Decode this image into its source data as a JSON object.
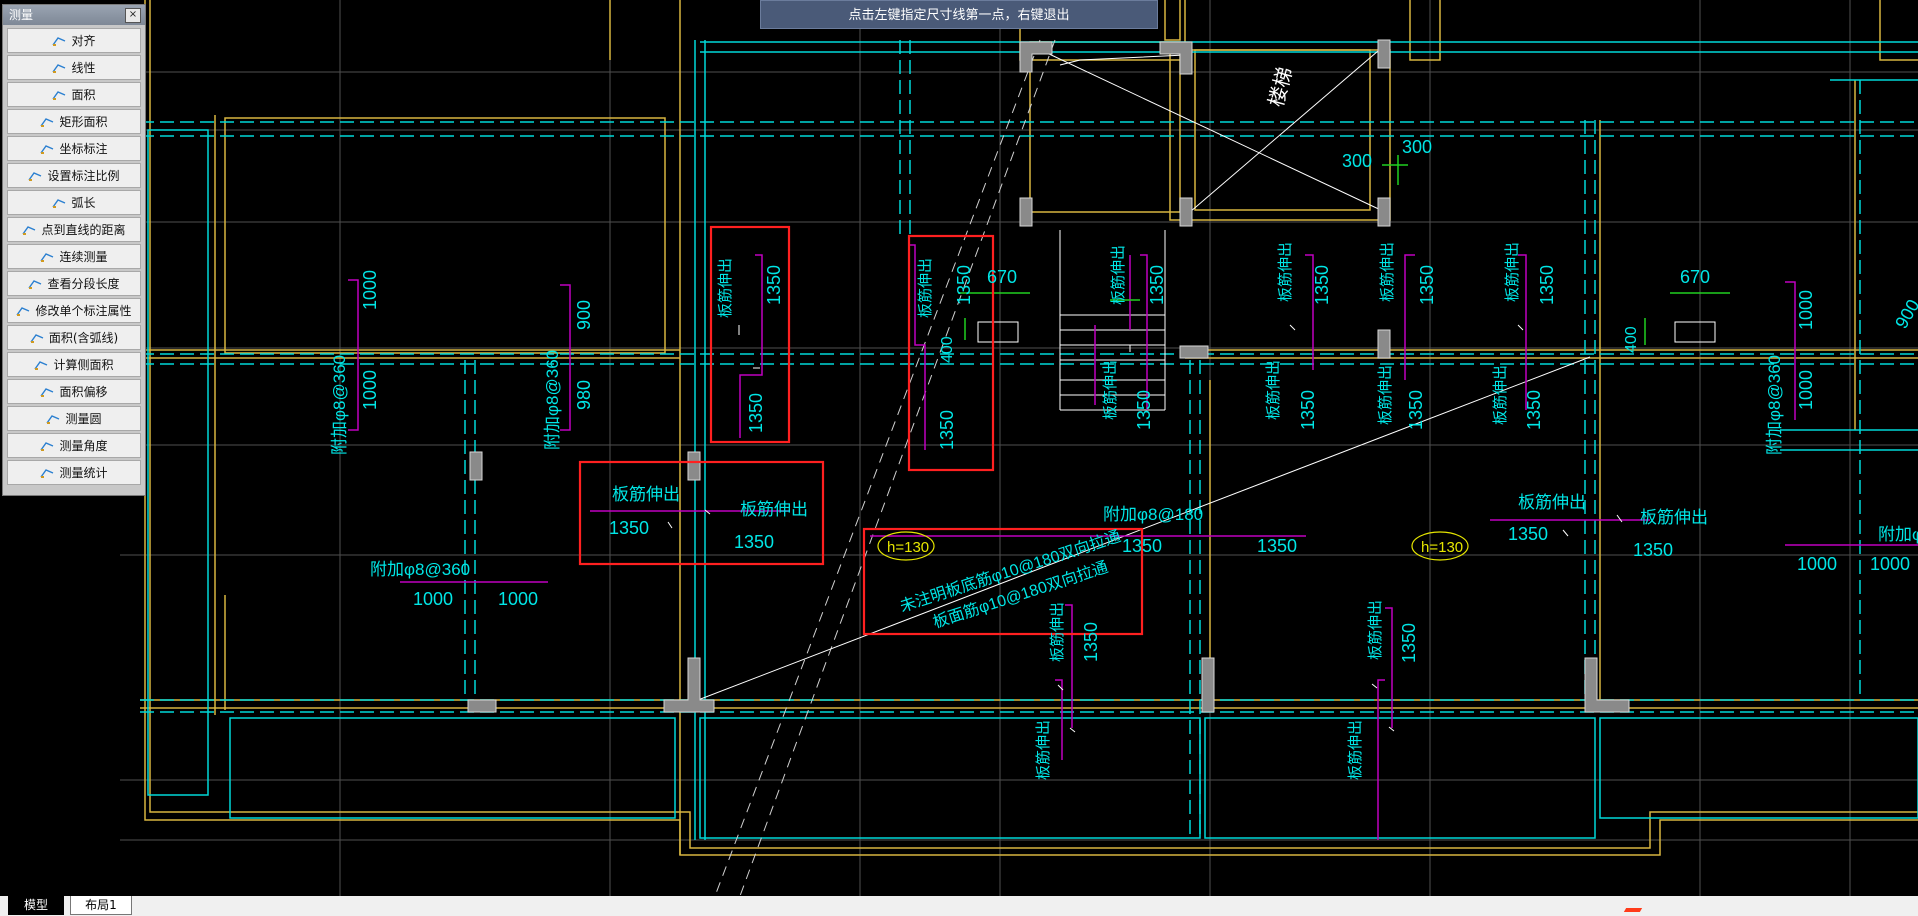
{
  "prompt": {
    "text": "点击左键指定尺寸线第一点，右键退出"
  },
  "panel": {
    "title": "测量",
    "close": "×",
    "items": [
      {
        "label": "对齐",
        "icon": "align-measure-icon"
      },
      {
        "label": "线性",
        "icon": "linear-measure-icon"
      },
      {
        "label": "面积",
        "icon": "area-icon"
      },
      {
        "label": "矩形面积",
        "icon": "rect-area-icon"
      },
      {
        "label": "坐标标注",
        "icon": "coordinate-icon"
      },
      {
        "label": "设置标注比例",
        "icon": "scale-icon"
      },
      {
        "label": "弧长",
        "icon": "arc-length-icon"
      },
      {
        "label": "点到直线的距离",
        "icon": "point-line-distance-icon"
      },
      {
        "label": "连续测量",
        "icon": "continuous-measure-icon"
      },
      {
        "label": "查看分段长度",
        "icon": "segment-length-icon"
      },
      {
        "label": "修改单个标注属性",
        "icon": "edit-dimension-icon"
      },
      {
        "label": "面积(含弧线)",
        "icon": "arc-area-icon"
      },
      {
        "label": "计算侧面积",
        "icon": "side-area-icon"
      },
      {
        "label": "面积偏移",
        "icon": "area-offset-icon"
      },
      {
        "label": "测量圆",
        "icon": "measure-circle-icon"
      },
      {
        "label": "测量角度",
        "icon": "measure-angle-icon"
      },
      {
        "label": "测量统计",
        "icon": "measure-stats-icon"
      }
    ]
  },
  "tabs": {
    "model": "模型",
    "layout": "布局1"
  },
  "drawing": {
    "stair": "楼梯",
    "extend": "板筋伸出",
    "n1350": "1350",
    "n1000": "1000",
    "n900": "900",
    "n980": "980",
    "n670": "670",
    "n400": "400",
    "n300": "300",
    "add360": "附加φ8@360",
    "add180": "附加φ8@180",
    "h130": "h=130",
    "note1": "未注明板底筋φ10@180双向拉通",
    "note2": "板面筋φ10@180双向拉通"
  },
  "colors": {
    "cyan": "#00e6e6",
    "yellow": "#d7b640",
    "magenta": "#c000c0",
    "red": "#ff2020",
    "green": "#20d020",
    "grid": "#4a4a4a"
  }
}
